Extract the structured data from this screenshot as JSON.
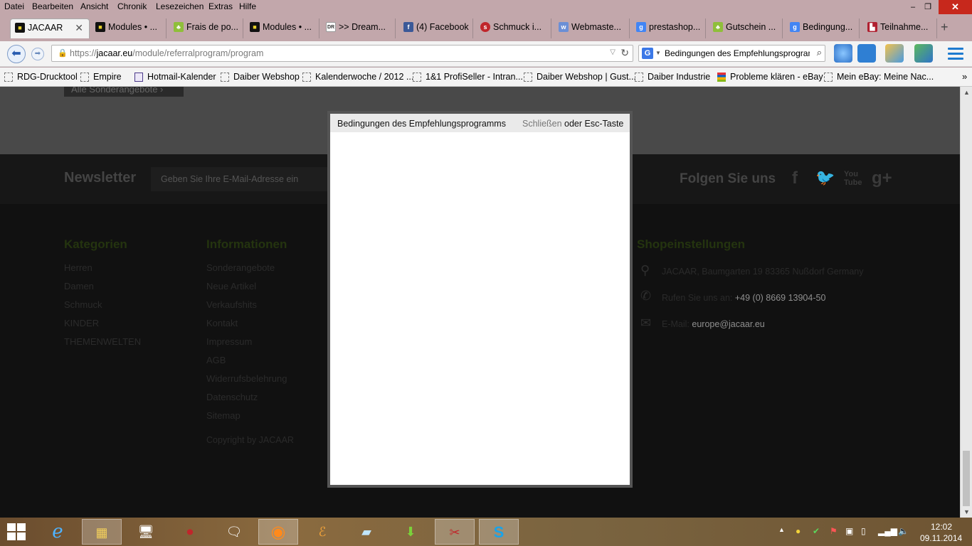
{
  "menu": [
    "Datei",
    "Bearbeiten",
    "Ansicht",
    "Chronik",
    "Lesezeichen",
    "Extras",
    "Hilfe"
  ],
  "window_controls": {
    "minimize": "‒",
    "maximize": "❐",
    "close": "✕"
  },
  "tabs": [
    {
      "label": "JACAAR",
      "icon": "jacaar-icon"
    },
    {
      "label": "Modules • ...",
      "icon": "jacaar-icon"
    },
    {
      "label": "Frais de po...",
      "icon": "prestashop-icon"
    },
    {
      "label": "Modules • ...",
      "icon": "jacaar-icon"
    },
    {
      "label": ">> Dream...",
      "icon": "dr-icon"
    },
    {
      "label": "(4) Facebook",
      "icon": "facebook-icon"
    },
    {
      "label": "Schmuck i...",
      "icon": "schmuck-icon"
    },
    {
      "label": "Webmaste...",
      "icon": "webmaster-icon"
    },
    {
      "label": "prestashop...",
      "icon": "google-icon"
    },
    {
      "label": "Gutschein ...",
      "icon": "prestashop-icon"
    },
    {
      "label": "Bedingung...",
      "icon": "google-icon"
    },
    {
      "label": "Teilnahme...",
      "icon": "teilnahme-icon"
    }
  ],
  "newtab_label": "+",
  "url": {
    "prefix": "https://",
    "host": "jacaar.eu",
    "path": "/module/referralprogram/program"
  },
  "search": {
    "text": "Bedingungen des Empfehlungsprogrammes",
    "engine": "G"
  },
  "bookmarks": [
    "RDG-Drucktool",
    "Empire",
    "Hotmail-Kalender",
    "Daiber Webshop",
    "Kalenderwoche / 2012 ...",
    "1&1 ProfiSeller - Intran...",
    "Daiber Webshop | Gust...",
    "Daiber Industrie",
    "Probleme klären - eBay",
    "Mein eBay: Meine Nac..."
  ],
  "bookmarks_more": "»",
  "page": {
    "sonder_button": "Alle Sonderangebote ›",
    "newsletter_title": "Newsletter",
    "newsletter_placeholder": "Geben Sie Ihre E-Mail-Adresse ein",
    "follow_title": "Folgen Sie uns",
    "social": [
      "f",
      "🐦",
      "You\nTube",
      "g+"
    ],
    "categories_title": "Kategorien",
    "categories": [
      "Herren",
      "Damen",
      "Schmuck",
      "KINDER",
      "THEMENWELTEN"
    ],
    "info_title": "Informationen",
    "info_links": [
      "Sonderangebote",
      "Neue Artikel",
      "Verkaufshits",
      "Kontakt",
      "Impressum",
      "AGB",
      "Widerrufsbelehrung",
      "Datenschutz",
      "Sitemap"
    ],
    "copyright": "Copyright by JACAAR",
    "shop_title": "Shopeinstellungen",
    "shop_address": "JACAAR, Baumgarten 19 83365 Nußdorf Germany",
    "shop_phone_label": "Rufen Sie uns an:",
    "shop_phone": "+49 (0) 8669 13904-50",
    "shop_email_label": "E-Mail:",
    "shop_email": "europe@jacaar.eu"
  },
  "modal": {
    "title": "Bedingungen des Empfehlungsprogramms",
    "close_label": "Schließen",
    "esc_label": "oder Esc-Taste"
  },
  "scrollbar": {
    "up": "▲",
    "down": "▼"
  },
  "clock": {
    "time": "12:02",
    "date": "09.11.2014"
  },
  "colors": {
    "accent_green": "#24340f",
    "page_bg": "#111111",
    "close_red": "#c7281c"
  }
}
